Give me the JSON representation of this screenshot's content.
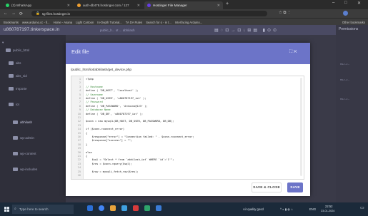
{
  "browser": {
    "tabs": [
      {
        "label": "(3) WhatsApp",
        "color": "#25d366"
      },
      {
        "label": "auth-db478.hostinger.com / 127",
        "color": "#f0a030"
      },
      {
        "label": "Hostinger File Manager",
        "color": "#673de6"
      }
    ],
    "url": "sg-files.hostinger.in",
    "bookmarks": [
      "Bookmarks",
      "www.arduino.cc - fi...",
      "Home - Asana",
      "Light Cartoon",
      "In-Depth Tutorial...",
      "TA DA Rules",
      "Search for o - in t...",
      "Interfacing Arduino...",
      "Other bookmarks"
    ]
  },
  "app": {
    "title": "u860787197.tinkerspace.in",
    "crumb": "public_h... ot ... abhilash",
    "right_panel_title": "Permissions",
    "right_panel_items": [
      "rw-r--r--",
      "rw-r--r--",
      "rw-r--r--"
    ],
    "sidebar": [
      "public_html",
      "abs",
      "abs_sid",
      "Importe",
      "iot",
      "abhilash",
      "wp-admin",
      "wp-content",
      "wp-includes"
    ]
  },
  "modal": {
    "title": "Edit file",
    "controls": "⛶ ✕",
    "path": "/public_html/iot/abhilash/get_device.php",
    "lines": [
      {
        "n": "1",
        "t": "<?php"
      },
      {
        "n": "2",
        "t": ""
      },
      {
        "n": "3",
        "t": "// Hostname"
      },
      {
        "n": "4",
        "t": "define ( 'DB_HOST', 'localhost' );"
      },
      {
        "n": "5",
        "t": "// Username"
      },
      {
        "n": "6",
        "t": "define ( 'DB_USER', 'u860787197_iot' );"
      },
      {
        "n": "7",
        "t": "// Password"
      },
      {
        "n": "8",
        "t": "define ( 'DB_PASSWORD', 'Arduino@123' );"
      },
      {
        "n": "9",
        "t": "// Database Name"
      },
      {
        "n": "10",
        "t": "define ( 'DB_DB', 'u860787197_iot' );"
      },
      {
        "n": "11",
        "t": ""
      },
      {
        "n": "12",
        "t": "$conn = new mysqli(DB_HOST, DB_USER, DB_PASSWORD, DB_DB);"
      },
      {
        "n": "13",
        "t": ""
      },
      {
        "n": "14",
        "t": "if ($conn->connect_error)"
      },
      {
        "n": "15",
        "t": "{"
      },
      {
        "n": "16",
        "t": "    $response[\"error\"] = \"Connection failed: \" . $conn->connect_error;"
      },
      {
        "n": "17",
        "t": "    $response[\"success\"] = \"\";"
      },
      {
        "n": "18",
        "t": "}"
      },
      {
        "n": "19",
        "t": ""
      },
      {
        "n": "20",
        "t": "else"
      },
      {
        "n": "21",
        "t": "{"
      },
      {
        "n": "22",
        "t": "    $sql = \"Select * from `abhilash_iot` WHERE `id`='1'\";"
      },
      {
        "n": "23",
        "t": "    $res = $conn->query($sql);"
      },
      {
        "n": "24",
        "t": ""
      },
      {
        "n": "25",
        "t": "    $row = mysqli_fetch_row($res);"
      },
      {
        "n": "26",
        "t": ""
      }
    ],
    "save_close": "SAVE & CLOSE",
    "save": "SAVE"
  },
  "taskbar": {
    "search": "Type here to search",
    "weather": "Air quality good",
    "lang": "ENG",
    "time": "22:52",
    "date": "23-01-2024"
  }
}
